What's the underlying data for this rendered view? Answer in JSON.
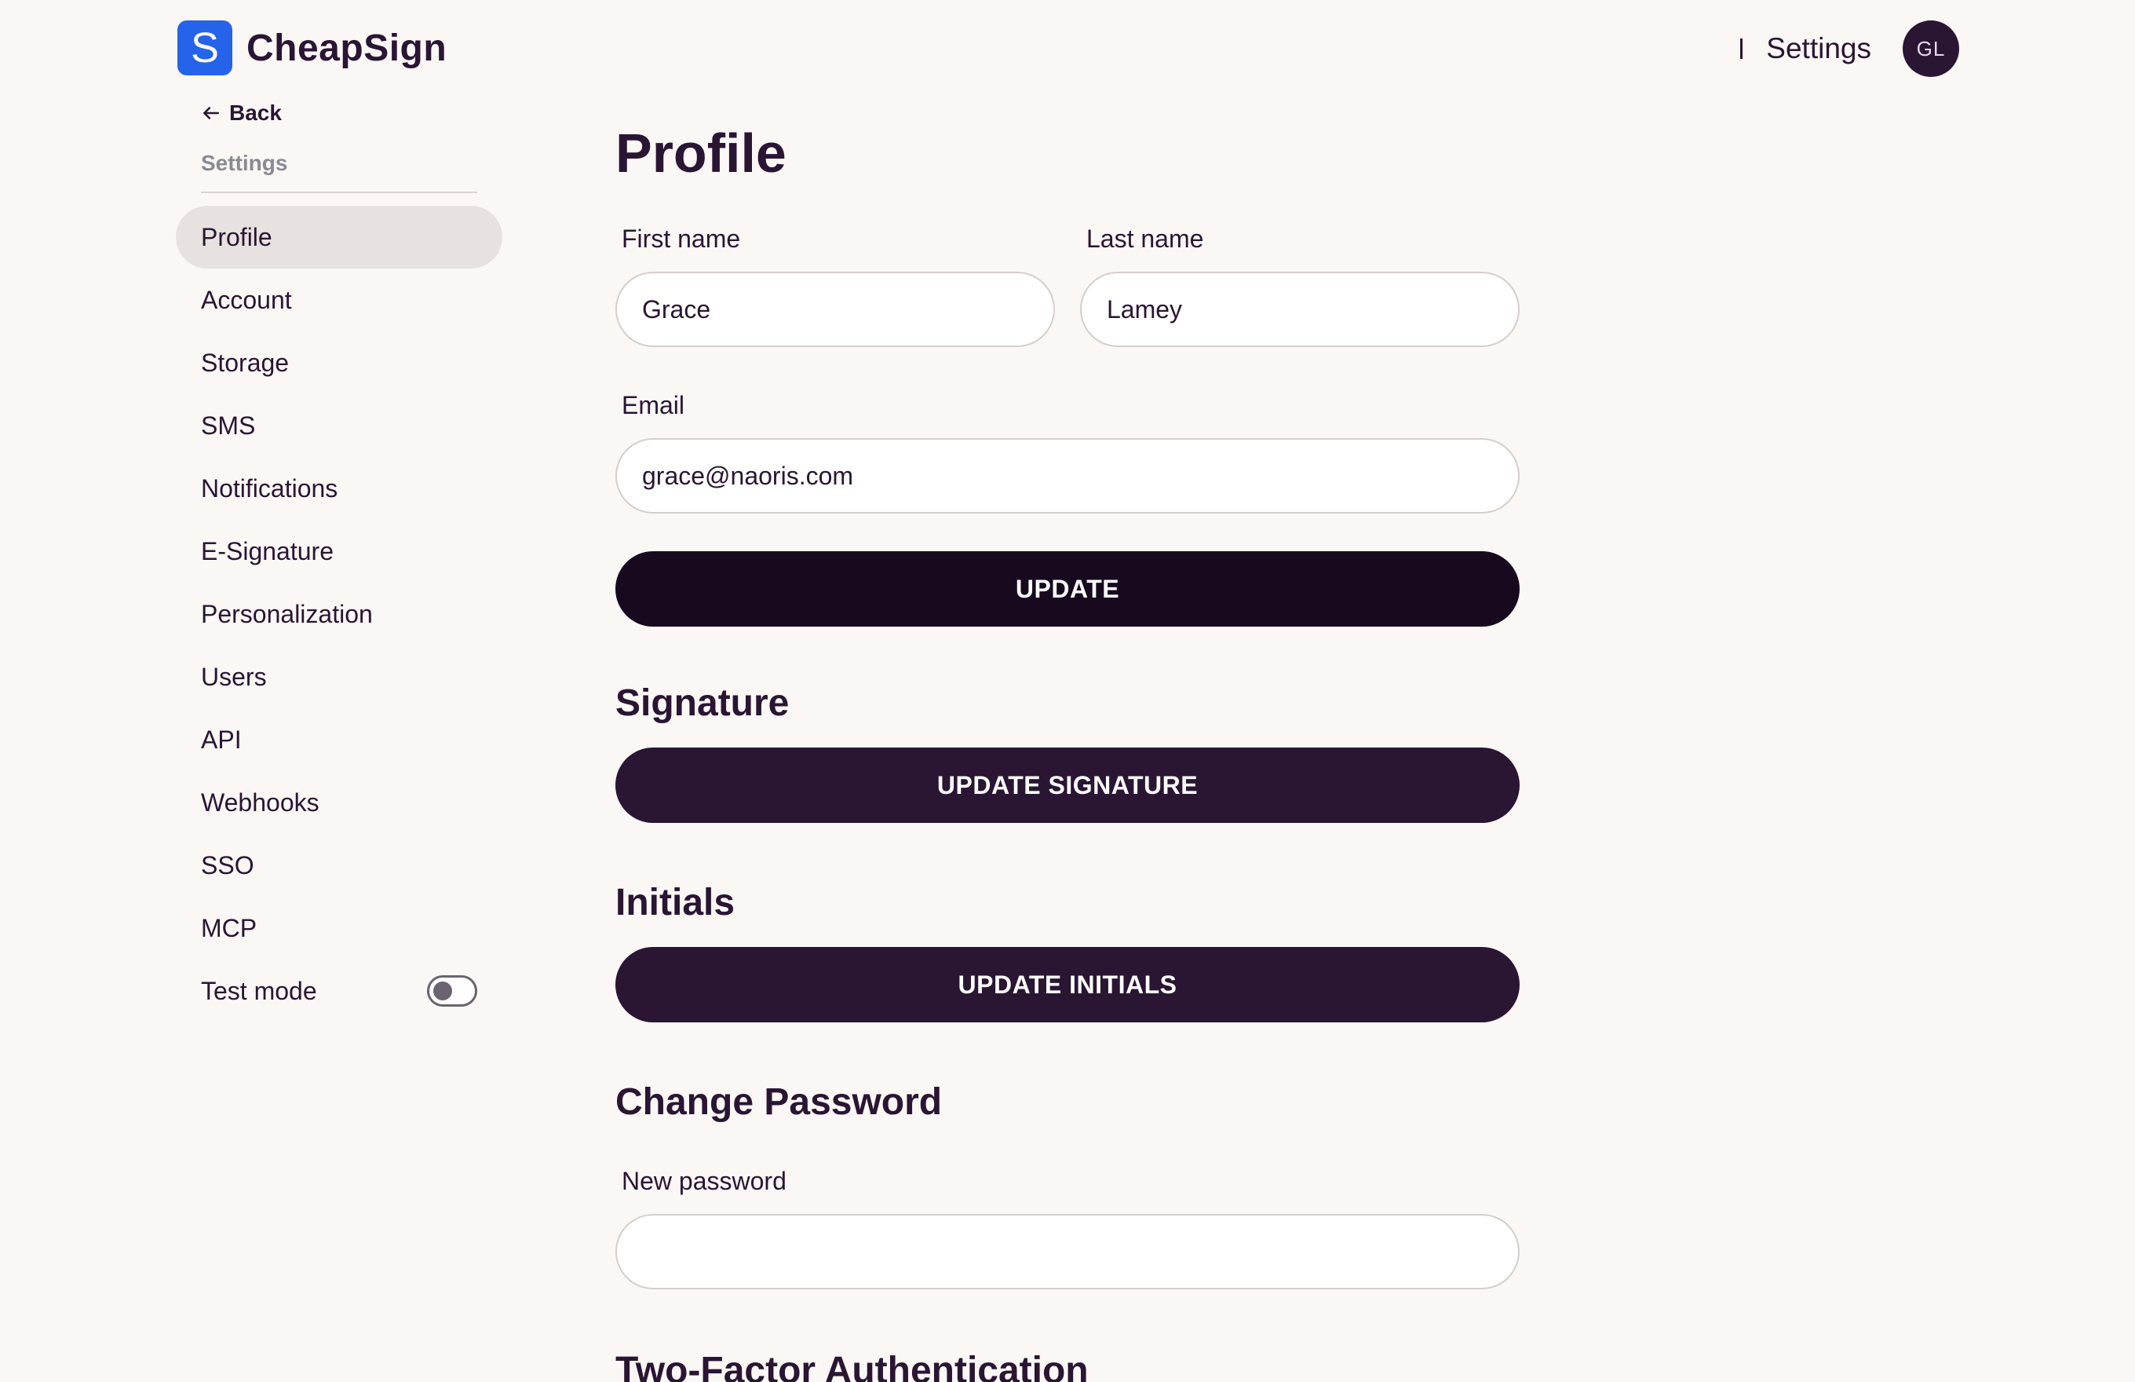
{
  "brand": {
    "logo_letter": "S",
    "name": "CheapSign",
    "accent": "#2563eb"
  },
  "topbar": {
    "settings_label": "Settings",
    "avatar_initials": "GL"
  },
  "sidebar": {
    "back_label": "Back",
    "heading": "Settings",
    "items": [
      {
        "label": "Profile",
        "active": true
      },
      {
        "label": "Account"
      },
      {
        "label": "Storage"
      },
      {
        "label": "SMS"
      },
      {
        "label": "Notifications"
      },
      {
        "label": "E-Signature"
      },
      {
        "label": "Personalization"
      },
      {
        "label": "Users"
      },
      {
        "label": "API"
      },
      {
        "label": "Webhooks"
      },
      {
        "label": "SSO"
      },
      {
        "label": "MCP"
      }
    ],
    "test_mode": {
      "label": "Test mode",
      "enabled": false
    }
  },
  "profile": {
    "title": "Profile",
    "first_name": {
      "label": "First name",
      "value": "Grace"
    },
    "last_name": {
      "label": "Last name",
      "value": "Lamey"
    },
    "email": {
      "label": "Email",
      "value": "grace@naoris.com"
    },
    "update_label": "UPDATE"
  },
  "signature": {
    "title": "Signature",
    "button_label": "UPDATE SIGNATURE"
  },
  "initials": {
    "title": "Initials",
    "button_label": "UPDATE INITIALS"
  },
  "password": {
    "title": "Change Password",
    "new_label": "New password",
    "new_value": ""
  },
  "two_factor": {
    "title": "Two-Factor Authentication"
  },
  "colors": {
    "background": "#faf7f5",
    "text": "#2a1533",
    "button_dark": "#170a1f",
    "button_purple": "#2a1533",
    "nav_active": "#e7e2df"
  }
}
